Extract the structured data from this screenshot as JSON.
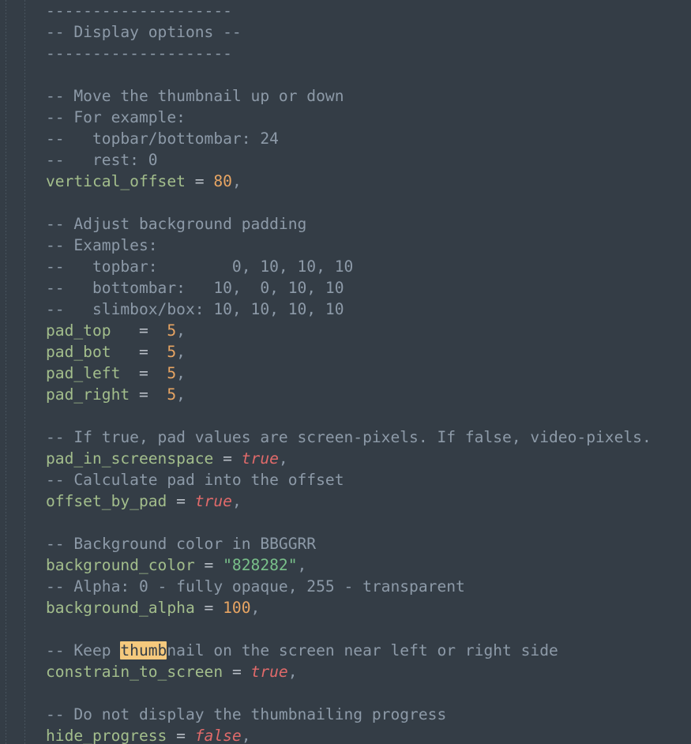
{
  "editor": {
    "app": "text-editor",
    "filetype": "lua",
    "background_color": "#343d46",
    "font_size_px": 19.6,
    "line_height_px": 27,
    "search_term": "thumb",
    "colors": {
      "background": "#343d46",
      "comment": "#8d9aa8",
      "identifier": "#a3be8c",
      "operator": "#b9bfc7",
      "number": "#e8a563",
      "string": "#79c08a",
      "boolean": "#e06a6a",
      "search_highlight_bg": "#f5c97d",
      "search_highlight_fg": "#343d46",
      "indent_guide": "#4f5b66"
    }
  },
  "lines": [
    {
      "id": "l01",
      "tokens": [
        {
          "t": "comment",
          "v": "--------------------"
        }
      ]
    },
    {
      "id": "l02",
      "tokens": [
        {
          "t": "comment",
          "v": "-- Display options --"
        }
      ]
    },
    {
      "id": "l03",
      "tokens": [
        {
          "t": "comment",
          "v": "--------------------"
        }
      ]
    },
    {
      "id": "l04",
      "tokens": []
    },
    {
      "id": "l05",
      "tokens": [
        {
          "t": "comment",
          "v": "-- Move the thumbnail up or down"
        }
      ]
    },
    {
      "id": "l06",
      "tokens": [
        {
          "t": "comment",
          "v": "-- For example:"
        }
      ]
    },
    {
      "id": "l07",
      "tokens": [
        {
          "t": "comment",
          "v": "--   topbar/bottombar: 24"
        }
      ]
    },
    {
      "id": "l08",
      "tokens": [
        {
          "t": "comment",
          "v": "--   rest: 0"
        }
      ]
    },
    {
      "id": "l09",
      "tokens": [
        {
          "t": "ident",
          "v": "vertical_offset"
        },
        {
          "t": "plain",
          "v": " "
        },
        {
          "t": "op",
          "v": "="
        },
        {
          "t": "plain",
          "v": " "
        },
        {
          "t": "number",
          "v": "80"
        },
        {
          "t": "punct",
          "v": ","
        }
      ]
    },
    {
      "id": "l10",
      "tokens": []
    },
    {
      "id": "l11",
      "tokens": [
        {
          "t": "comment",
          "v": "-- Adjust background padding"
        }
      ]
    },
    {
      "id": "l12",
      "tokens": [
        {
          "t": "comment",
          "v": "-- Examples:"
        }
      ]
    },
    {
      "id": "l13",
      "tokens": [
        {
          "t": "comment",
          "v": "--   topbar:        0, 10, 10, 10"
        }
      ]
    },
    {
      "id": "l14",
      "tokens": [
        {
          "t": "comment",
          "v": "--   bottombar:   10,  0, 10, 10"
        }
      ]
    },
    {
      "id": "l15",
      "tokens": [
        {
          "t": "comment",
          "v": "--   slimbox/box: 10, 10, 10, 10"
        }
      ]
    },
    {
      "id": "l16",
      "tokens": [
        {
          "t": "ident",
          "v": "pad_top"
        },
        {
          "t": "plain",
          "v": "   "
        },
        {
          "t": "op",
          "v": "="
        },
        {
          "t": "plain",
          "v": "  "
        },
        {
          "t": "number",
          "v": "5"
        },
        {
          "t": "punct",
          "v": ","
        }
      ]
    },
    {
      "id": "l17",
      "tokens": [
        {
          "t": "ident",
          "v": "pad_bot"
        },
        {
          "t": "plain",
          "v": "   "
        },
        {
          "t": "op",
          "v": "="
        },
        {
          "t": "plain",
          "v": "  "
        },
        {
          "t": "number",
          "v": "5"
        },
        {
          "t": "punct",
          "v": ","
        }
      ]
    },
    {
      "id": "l18",
      "tokens": [
        {
          "t": "ident",
          "v": "pad_left"
        },
        {
          "t": "plain",
          "v": "  "
        },
        {
          "t": "op",
          "v": "="
        },
        {
          "t": "plain",
          "v": "  "
        },
        {
          "t": "number",
          "v": "5"
        },
        {
          "t": "punct",
          "v": ","
        }
      ]
    },
    {
      "id": "l19",
      "tokens": [
        {
          "t": "ident",
          "v": "pad_right"
        },
        {
          "t": "plain",
          "v": " "
        },
        {
          "t": "op",
          "v": "="
        },
        {
          "t": "plain",
          "v": "  "
        },
        {
          "t": "number",
          "v": "5"
        },
        {
          "t": "punct",
          "v": ","
        }
      ]
    },
    {
      "id": "l20",
      "tokens": []
    },
    {
      "id": "l21",
      "tokens": [
        {
          "t": "comment",
          "v": "-- If true, pad values are screen-pixels. If false, video-pixels."
        }
      ]
    },
    {
      "id": "l22",
      "tokens": [
        {
          "t": "ident",
          "v": "pad_in_screenspace"
        },
        {
          "t": "plain",
          "v": " "
        },
        {
          "t": "op",
          "v": "="
        },
        {
          "t": "plain",
          "v": " "
        },
        {
          "t": "bool",
          "v": "true"
        },
        {
          "t": "punct",
          "v": ","
        }
      ]
    },
    {
      "id": "l23",
      "tokens": [
        {
          "t": "comment",
          "v": "-- Calculate pad into the offset"
        }
      ]
    },
    {
      "id": "l24",
      "tokens": [
        {
          "t": "ident",
          "v": "offset_by_pad"
        },
        {
          "t": "plain",
          "v": " "
        },
        {
          "t": "op",
          "v": "="
        },
        {
          "t": "plain",
          "v": " "
        },
        {
          "t": "bool",
          "v": "true"
        },
        {
          "t": "punct",
          "v": ","
        }
      ]
    },
    {
      "id": "l25",
      "tokens": []
    },
    {
      "id": "l26",
      "tokens": [
        {
          "t": "comment",
          "v": "-- Background color in BBGGRR"
        }
      ]
    },
    {
      "id": "l27",
      "tokens": [
        {
          "t": "ident",
          "v": "background_color"
        },
        {
          "t": "plain",
          "v": " "
        },
        {
          "t": "op",
          "v": "="
        },
        {
          "t": "plain",
          "v": " "
        },
        {
          "t": "string",
          "v": "\"828282\""
        },
        {
          "t": "punct",
          "v": ","
        }
      ]
    },
    {
      "id": "l28",
      "tokens": [
        {
          "t": "comment",
          "v": "-- Alpha: 0 - fully opaque, 255 - transparent"
        }
      ]
    },
    {
      "id": "l29",
      "tokens": [
        {
          "t": "ident",
          "v": "background_alpha"
        },
        {
          "t": "plain",
          "v": " "
        },
        {
          "t": "op",
          "v": "="
        },
        {
          "t": "plain",
          "v": " "
        },
        {
          "t": "number",
          "v": "100"
        },
        {
          "t": "punct",
          "v": ","
        }
      ]
    },
    {
      "id": "l30",
      "tokens": []
    },
    {
      "id": "l31",
      "tokens": [
        {
          "t": "comment",
          "v": "-- Keep "
        },
        {
          "t": "hit",
          "v": "thumb"
        },
        {
          "t": "comment",
          "v": "nail on the screen near left or right side"
        }
      ]
    },
    {
      "id": "l32",
      "tokens": [
        {
          "t": "ident",
          "v": "constrain_to_screen"
        },
        {
          "t": "plain",
          "v": " "
        },
        {
          "t": "op",
          "v": "="
        },
        {
          "t": "plain",
          "v": " "
        },
        {
          "t": "bool",
          "v": "true"
        },
        {
          "t": "punct",
          "v": ","
        }
      ]
    },
    {
      "id": "l33",
      "tokens": []
    },
    {
      "id": "l34",
      "tokens": [
        {
          "t": "comment",
          "v": "-- Do not display the thumbnailing progress"
        }
      ]
    },
    {
      "id": "l35",
      "tokens": [
        {
          "t": "ident",
          "v": "hide_progress"
        },
        {
          "t": "plain",
          "v": " "
        },
        {
          "t": "op",
          "v": "="
        },
        {
          "t": "plain",
          "v": " "
        },
        {
          "t": "bool",
          "v": "false"
        },
        {
          "t": "punct",
          "v": ","
        }
      ]
    }
  ]
}
